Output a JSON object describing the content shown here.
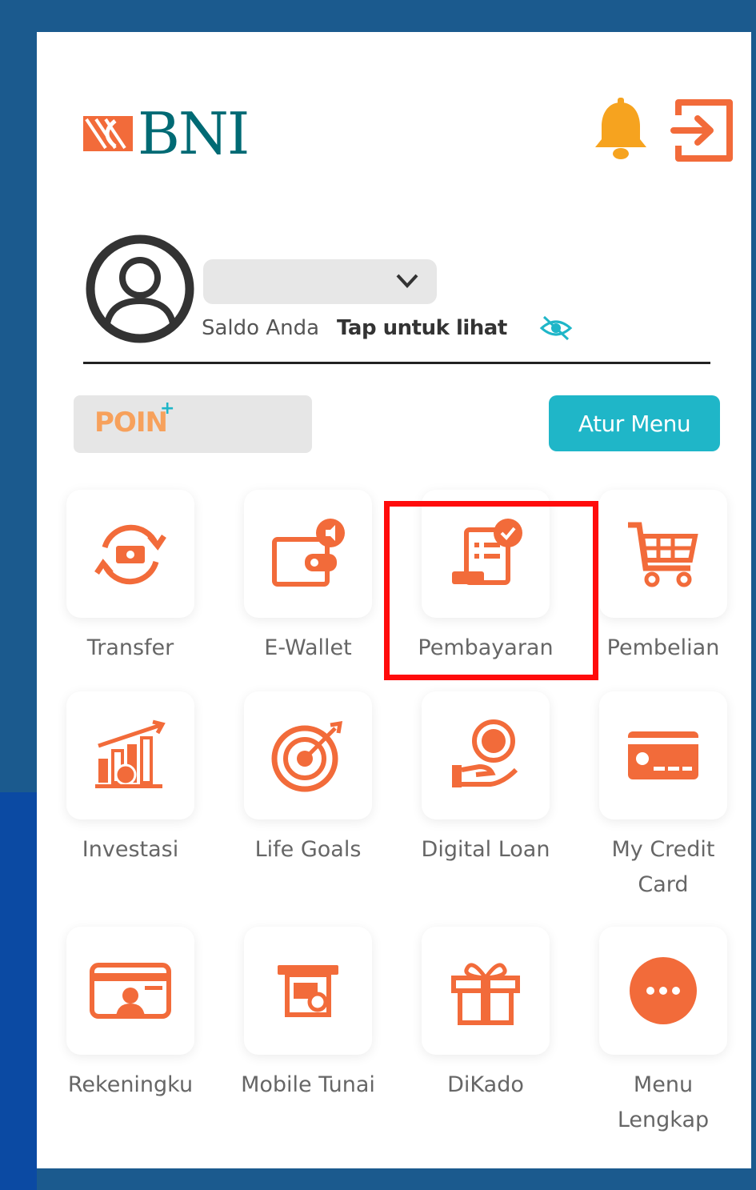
{
  "header": {
    "logo_text": "BNI",
    "notification_icon": "bell-icon",
    "logout_icon": "logout-icon"
  },
  "profile": {
    "avatar_icon": "user-avatar-icon",
    "account_dropdown_icon": "chevron-down-icon",
    "balance_label": "Saldo Anda",
    "balance_hint": "Tap untuk lihat",
    "visibility_icon": "eye-off-icon"
  },
  "poin": {
    "label": "POIN",
    "plus": "+"
  },
  "atur_menu": {
    "label": "Atur Menu"
  },
  "menu": [
    {
      "label": "Transfer",
      "icon": "transfer-icon"
    },
    {
      "label": "E-Wallet",
      "icon": "e-wallet-icon"
    },
    {
      "label": "Pembayaran",
      "icon": "payment-icon"
    },
    {
      "label": "Pembelian",
      "icon": "cart-icon"
    },
    {
      "label": "Investasi",
      "icon": "investment-chart-icon"
    },
    {
      "label": "Life Goals",
      "icon": "target-icon"
    },
    {
      "label": "Digital Loan",
      "icon": "loan-hand-icon"
    },
    {
      "label": "My Credit",
      "label2": "Card",
      "icon": "credit-card-icon"
    },
    {
      "label": "Rekeningku",
      "icon": "account-card-icon"
    },
    {
      "label": "Mobile Tunai",
      "icon": "atm-cash-icon"
    },
    {
      "label": "DiKado",
      "icon": "gift-icon"
    },
    {
      "label": "Menu",
      "label2": "Lengkap",
      "icon": "more-icon"
    }
  ],
  "colors": {
    "brand_orange": "#f26b3a",
    "brand_teal": "#006a74",
    "accent_cyan": "#1fb6c8",
    "highlight_red": "#ff0b0b",
    "frame_blue": "#1b5a8e"
  }
}
